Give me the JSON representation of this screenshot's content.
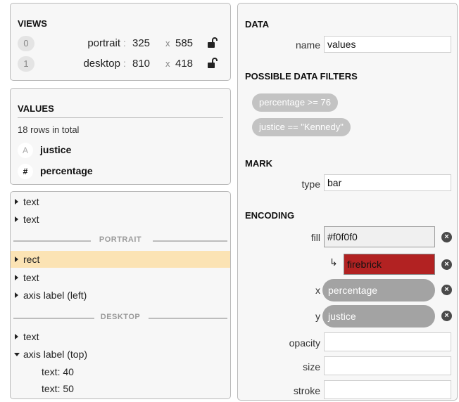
{
  "views": {
    "heading": "VIEWS",
    "items": [
      {
        "index": "0",
        "name": "portrait",
        "colon": ":",
        "width": "325",
        "times": "x",
        "height": "585"
      },
      {
        "index": "1",
        "name": "desktop",
        "colon": ":",
        "width": "810",
        "times": "x",
        "height": "418"
      }
    ]
  },
  "values": {
    "heading": "VALUES",
    "row_count": "18 rows in total",
    "fields": [
      {
        "type_glyph": "A",
        "name": "justice"
      },
      {
        "type_glyph": "#",
        "name": "percentage"
      }
    ]
  },
  "layers": {
    "items": [
      {
        "label": "text"
      },
      {
        "label": "text"
      },
      {
        "section": "PORTRAIT"
      },
      {
        "label": "rect"
      },
      {
        "label": "text"
      },
      {
        "label": "axis label (left)"
      },
      {
        "section": "DESKTOP"
      },
      {
        "label": "text"
      },
      {
        "label": "axis label (top)"
      }
    ],
    "sub_items": [
      "text: 40",
      "text: 50"
    ]
  },
  "data_panel": {
    "heading": "DATA",
    "name_label": "name",
    "name_value": "values"
  },
  "filters": {
    "heading": "POSSIBLE DATA FILTERS",
    "items": [
      "percentage >= 76",
      "justice == \"Kennedy\""
    ]
  },
  "mark": {
    "heading": "MARK",
    "type_label": "type",
    "type_value": "bar"
  },
  "encoding": {
    "heading": "ENCODING",
    "fill_label": "fill",
    "fill_value": "#f0f0f0",
    "arrow": "↳",
    "fill_override": "firebrick",
    "fill_override_color": "#b22222",
    "x_label": "x",
    "x_field": "percentage",
    "y_label": "y",
    "y_field": "justice",
    "opacity_label": "opacity",
    "size_label": "size",
    "stroke_label": "stroke",
    "remove_glyph": "×"
  }
}
